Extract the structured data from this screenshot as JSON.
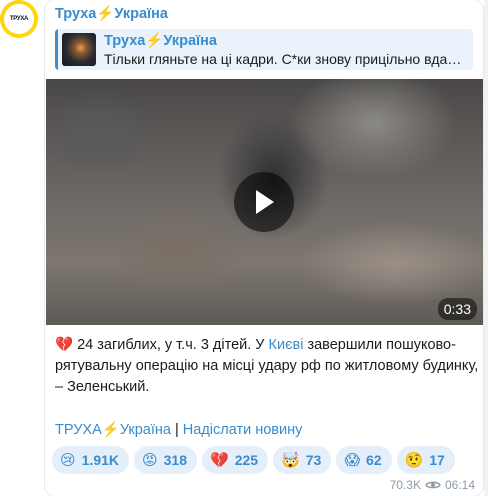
{
  "channel": {
    "name": "Труха⚡️Україна",
    "avatar_text": "ТРУХА"
  },
  "reply": {
    "title": "Труха⚡️Україна",
    "text": "Тільки гляньте на ці кадри. С*ки знову прицільно вдарили по житловому будинку"
  },
  "video": {
    "duration": "0:33"
  },
  "message": {
    "emoji": "💔",
    "part1": " 24 загиблих, у т.ч. 3 дітей. У ",
    "link": "Києві",
    "part2": " завершили пошуково-рятувальну операцію на місці удару рф по житловому будинку, – Зеленський."
  },
  "footer": {
    "link1": "ТРУХА⚡️Україна",
    "separator": " | ",
    "link2": "Надіслати новину"
  },
  "reactions": [
    {
      "emoji": "😢",
      "count": "1.91K"
    },
    {
      "emoji": "😡",
      "count": "318"
    },
    {
      "emoji": "💔",
      "count": "225"
    },
    {
      "emoji": "🤯",
      "count": "73"
    },
    {
      "emoji": "😱",
      "count": "62"
    },
    {
      "emoji": "🤨",
      "count": "17"
    }
  ],
  "meta": {
    "views": "70.3K",
    "time": "06:14"
  },
  "colors": {
    "accent": "#3a8ccc",
    "avatar_ring": "#ffd60a"
  }
}
